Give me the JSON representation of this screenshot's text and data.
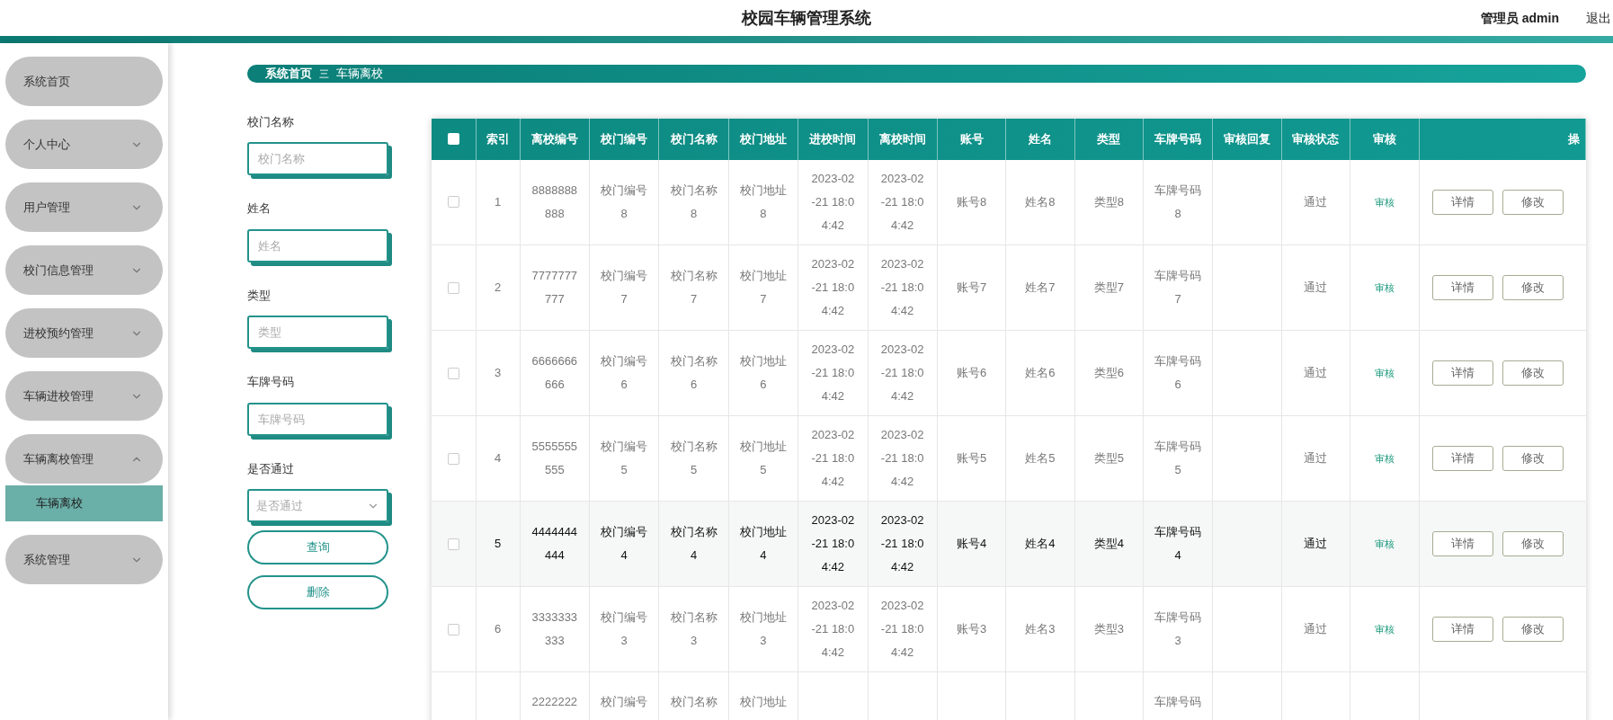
{
  "header": {
    "title": "校园车辆管理系统",
    "user": "管理员 admin",
    "logout": "退出"
  },
  "sidebar": {
    "items": [
      {
        "label": "系统首页"
      },
      {
        "label": "个人中心",
        "expanded": false
      },
      {
        "label": "用户管理",
        "expanded": false
      },
      {
        "label": "校门信息管理",
        "expanded": false
      },
      {
        "label": "进校预约管理",
        "expanded": false
      },
      {
        "label": "车辆进校管理",
        "expanded": false
      },
      {
        "label": "车辆离校管理",
        "expanded": true,
        "children": [
          {
            "label": "车辆离校",
            "selected": true
          }
        ]
      },
      {
        "label": "系统管理",
        "expanded": false
      }
    ]
  },
  "breadcrumb": {
    "items": [
      "系统首页",
      "车辆离校"
    ],
    "separator": "三"
  },
  "filters": [
    {
      "kind": "input",
      "label": "校门名称",
      "placeholder": "校门名称"
    },
    {
      "kind": "input",
      "label": "姓名",
      "placeholder": "姓名"
    },
    {
      "kind": "input",
      "label": "类型",
      "placeholder": "类型"
    },
    {
      "kind": "input",
      "label": "车牌号码",
      "placeholder": "车牌号码"
    },
    {
      "kind": "select",
      "label": "是否通过",
      "placeholder": "是否通过"
    }
  ],
  "filter_buttons": [
    "查询",
    "删除"
  ],
  "table": {
    "all_checked": false,
    "columns": [
      "索引",
      "离校编号",
      "校门编号",
      "校门名称",
      "校门地址",
      "进校时间",
      "离校时间",
      "账号",
      "姓名",
      "类型",
      "车牌号码",
      "审核回复",
      "审核状态",
      "审核",
      "操"
    ],
    "rows": [
      {
        "highlighted": false,
        "checked": false,
        "cells": {
          "index": "1",
          "leave_no": "8888888888",
          "gate_no": "校门编号8",
          "gate_name": "校门名称8",
          "gate_addr": "校门地址8",
          "in_time": "2023-02-21 18:04:42",
          "out_time": "2023-02-21 18:04:42",
          "account": "账号8",
          "name": "姓名8",
          "type": "类型8",
          "plate": "车牌号码8",
          "status": "通过"
        },
        "review": "审核",
        "actions": [
          "详情",
          "修改"
        ]
      },
      {
        "highlighted": false,
        "checked": false,
        "cells": {
          "index": "2",
          "leave_no": "7777777777",
          "gate_no": "校门编号7",
          "gate_name": "校门名称7",
          "gate_addr": "校门地址7",
          "in_time": "2023-02-21 18:04:42",
          "out_time": "2023-02-21 18:04:42",
          "account": "账号7",
          "name": "姓名7",
          "type": "类型7",
          "plate": "车牌号码7",
          "status": "通过"
        },
        "review": "审核",
        "actions": [
          "详情",
          "修改"
        ]
      },
      {
        "highlighted": false,
        "checked": false,
        "cells": {
          "index": "3",
          "leave_no": "6666666666",
          "gate_no": "校门编号6",
          "gate_name": "校门名称6",
          "gate_addr": "校门地址6",
          "in_time": "2023-02-21 18:04:42",
          "out_time": "2023-02-21 18:04:42",
          "account": "账号6",
          "name": "姓名6",
          "type": "类型6",
          "plate": "车牌号码6",
          "status": "通过"
        },
        "review": "审核",
        "actions": [
          "详情",
          "修改"
        ]
      },
      {
        "highlighted": false,
        "checked": false,
        "cells": {
          "index": "4",
          "leave_no": "5555555555",
          "gate_no": "校门编号5",
          "gate_name": "校门名称5",
          "gate_addr": "校门地址5",
          "in_time": "2023-02-21 18:04:42",
          "out_time": "2023-02-21 18:04:42",
          "account": "账号5",
          "name": "姓名5",
          "type": "类型5",
          "plate": "车牌号码5",
          "status": "通过"
        },
        "review": "审核",
        "actions": [
          "详情",
          "修改"
        ]
      },
      {
        "highlighted": true,
        "checked": false,
        "cells": {
          "index": "5",
          "leave_no": "4444444444",
          "gate_no": "校门编号4",
          "gate_name": "校门名称4",
          "gate_addr": "校门地址4",
          "in_time": "2023-02-21 18:04:42",
          "out_time": "2023-02-21 18:04:42",
          "account": "账号4",
          "name": "姓名4",
          "type": "类型4",
          "plate": "车牌号码4",
          "status": "通过"
        },
        "review": "审核",
        "actions": [
          "详情",
          "修改"
        ]
      },
      {
        "highlighted": false,
        "checked": false,
        "cells": {
          "index": "6",
          "leave_no": "3333333333",
          "gate_no": "校门编号3",
          "gate_name": "校门名称3",
          "gate_addr": "校门地址3",
          "in_time": "2023-02-21 18:04:42",
          "out_time": "2023-02-21 18:04:42",
          "account": "账号3",
          "name": "姓名3",
          "type": "类型3",
          "plate": "车牌号码3",
          "status": "通过"
        },
        "review": "审核",
        "actions": [
          "详情",
          "修改"
        ]
      },
      {
        "highlighted": false,
        "cells": {
          "leave_no": "2222222",
          "gate_no": "校门编号",
          "gate_name": "校门名称",
          "gate_addr": "校门地址",
          "plate": "车牌号码"
        }
      }
    ]
  }
}
